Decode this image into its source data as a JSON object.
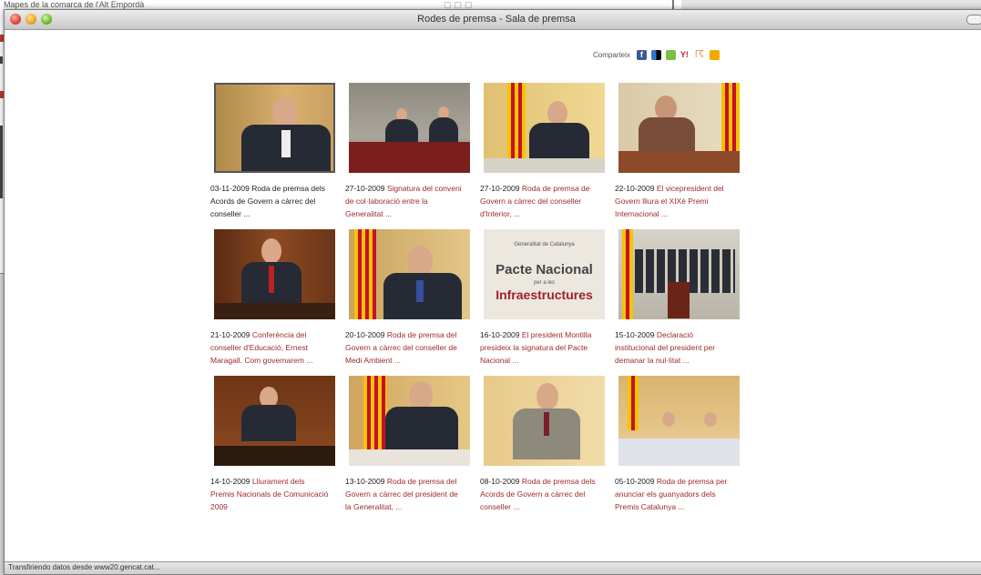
{
  "background_window": {
    "title": "Mapes de la comarca de l'Alt Empordà"
  },
  "window": {
    "title": "Rodes de premsa - Sala de premsa"
  },
  "share": {
    "label": "Comparteix",
    "icons": [
      "facebook-icon",
      "delicious-icon",
      "meneame-icon",
      "yahoo-icon",
      "rss-icon",
      "star-icon"
    ]
  },
  "items": [
    {
      "date": "03-11-2009",
      "text": "Roda de premsa dels Acords de Govern a càrrec del conseller ..."
    },
    {
      "date": "27-10-2009",
      "text": "Signatura del conveni de col·laboració entre la Generalitat ..."
    },
    {
      "date": "27-10-2009",
      "text": "Roda de premsa de Govern a càrrec del conseller d'Interior, ..."
    },
    {
      "date": "22-10-2009",
      "text": "El vicepresident del Govern lliura el XIXè Premi Internacional ..."
    },
    {
      "date": "21-10-2009",
      "text": "Conferència del conseller d'Educació, Ernest Maragall. Com governarem ..."
    },
    {
      "date": "20-10-2009",
      "text": "Roda de premsa del Govern a càrrec del conseller de Medi Ambient ..."
    },
    {
      "date": "16-10-2009",
      "text": "El president Montilla presideix la signatura del Pacte Nacional ..."
    },
    {
      "date": "15-10-2009",
      "text": "Declaració institucional del president per demanar la nul·litat ..."
    },
    {
      "date": "14-10-2009",
      "text": "Lliurament dels Premis Nacionals de Comunicació 2009"
    },
    {
      "date": "13-10-2009",
      "text": "Roda de premsa del Govern a càrrec del president de la Generalitat, ..."
    },
    {
      "date": "08-10-2009",
      "text": "Roda de premsa dels Acords de Govern a càrrec del conseller ..."
    },
    {
      "date": "05-10-2009",
      "text": "Roda de premsa per anunciar els guanyadors dels Premis Catalunya ..."
    }
  ],
  "poster": {
    "line1": "Generalitat de Catalunya",
    "line2": "Pacte Nacional",
    "line3": "per a les",
    "line4": "Infraestructures"
  },
  "status": {
    "text": "Transfiriendo datos desde www20.gencat.cat..."
  },
  "colors": {
    "link": "#a02a2a",
    "accent_flag_yellow": "#f5c400",
    "accent_flag_red": "#c8102e"
  }
}
